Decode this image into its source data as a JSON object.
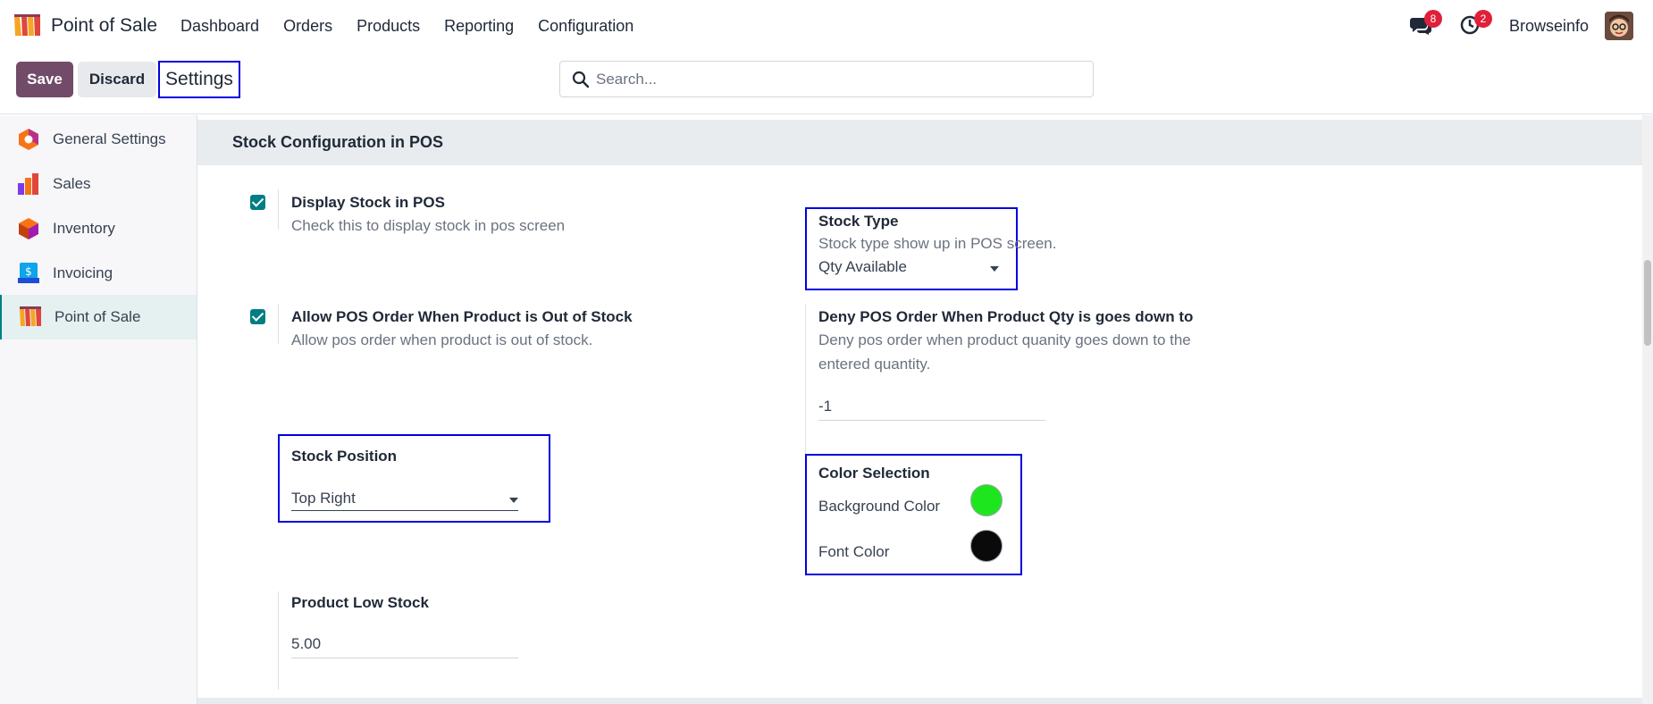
{
  "navbar": {
    "app_name": "Point of Sale",
    "menu": [
      "Dashboard",
      "Orders",
      "Products",
      "Reporting",
      "Configuration"
    ],
    "chat_badge": "8",
    "activity_badge": "2",
    "company": "Browseinfo"
  },
  "control": {
    "save_label": "Save",
    "discard_label": "Discard",
    "breadcrumb": "Settings",
    "search_placeholder": "Search..."
  },
  "sidebar": {
    "items": [
      {
        "label": "General Settings",
        "icon": "general-settings-icon"
      },
      {
        "label": "Sales",
        "icon": "sales-icon"
      },
      {
        "label": "Inventory",
        "icon": "inventory-icon"
      },
      {
        "label": "Invoicing",
        "icon": "invoicing-icon"
      },
      {
        "label": "Point of Sale",
        "icon": "point-of-sale-icon",
        "active": true
      }
    ]
  },
  "section": {
    "title": "Stock Configuration in POS",
    "display_stock": {
      "title": "Display Stock in POS",
      "desc": "Check this to display stock in pos screen",
      "checked": true
    },
    "stock_type": {
      "title": "Stock Type",
      "desc": "Stock type show up in POS screen.",
      "value": "Qty Available"
    },
    "allow_order": {
      "title": "Allow POS Order When Product is Out of Stock",
      "desc": "Allow pos order when product is out of stock.",
      "checked": true
    },
    "deny_order": {
      "title": "Deny POS Order When Product Qty is goes down to",
      "desc_line1": "Deny pos order when product quanity goes down to the",
      "desc_line2": "entered quantity.",
      "value": "-1"
    },
    "stock_position": {
      "title": "Stock Position",
      "value": "Top Right"
    },
    "color_selection": {
      "title": "Color Selection",
      "bg_label": "Background Color",
      "bg_color": "#1ee61e",
      "font_label": "Font Color",
      "font_color": "#0a0a0a"
    },
    "low_stock": {
      "title": "Product Low Stock",
      "value": "5.00"
    }
  },
  "colors": {
    "primary": "#714b67",
    "accent": "#017e84",
    "highlight_border": "#0000e0",
    "badge": "#e0203a"
  }
}
